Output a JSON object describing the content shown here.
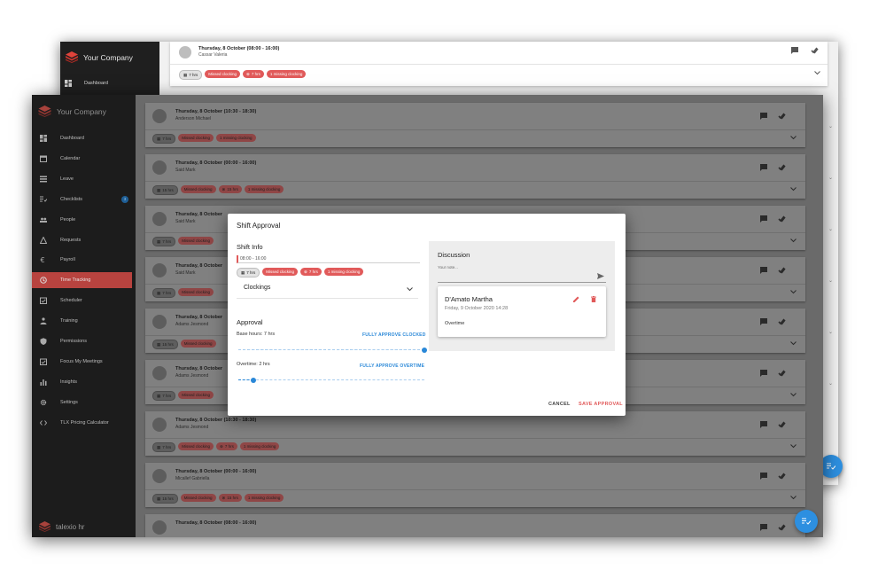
{
  "app": {
    "company_name": "Your Company",
    "footer_brand": "talexio hr"
  },
  "back_window": {
    "nav_item": "Dashboard",
    "card": {
      "title": "Thursday, 8 October (08:00 - 16:00)",
      "name": "Cassar Valeria",
      "chips": [
        "7 hrs",
        "Missed clocking",
        "7 hrs",
        "1 missing clocking"
      ]
    }
  },
  "sidebar": {
    "items": [
      {
        "label": "Dashboard",
        "icon": "dashboard-icon"
      },
      {
        "label": "Calendar",
        "icon": "calendar-icon"
      },
      {
        "label": "Leave",
        "icon": "leave-icon"
      },
      {
        "label": "Checklists",
        "icon": "checklist-icon",
        "badge": "3"
      },
      {
        "label": "People",
        "icon": "people-icon"
      },
      {
        "label": "Requests",
        "icon": "requests-icon"
      },
      {
        "label": "Payroll",
        "icon": "euro-icon"
      },
      {
        "label": "Time Tracking",
        "icon": "clock-icon",
        "active": true
      },
      {
        "label": "Scheduler",
        "icon": "scheduler-icon"
      },
      {
        "label": "Training",
        "icon": "training-icon"
      },
      {
        "label": "Permissions",
        "icon": "shield-icon"
      },
      {
        "label": "Focus My Meetings",
        "icon": "meetings-icon"
      },
      {
        "label": "Insights",
        "icon": "insights-icon"
      },
      {
        "label": "Settings",
        "icon": "gear-icon"
      },
      {
        "label": "TLX Pricing Calculator",
        "icon": "code-icon"
      }
    ]
  },
  "shifts": [
    {
      "title": "Thursday, 8 October (10:30 - 18:30)",
      "name": "Anderson Michael",
      "hours": "7 hrs",
      "missed": "Missed clocking",
      "clock_hours": "",
      "missing": "1 missing clocking"
    },
    {
      "title": "Thursday, 8 October (00:00 - 16:00)",
      "name": "Said Mark",
      "hours": "15 hrs",
      "missed": "Missed clocking",
      "clock_hours": "15 hrs",
      "missing": "1 missing clocking"
    },
    {
      "title": "Thursday, 8 October",
      "name": "Said Mark",
      "hours": "7 hrs",
      "missed": "Missed clocking",
      "clock_hours": "",
      "missing": ""
    },
    {
      "title": "Thursday, 8 October",
      "name": "Said Mark",
      "hours": "7 hrs",
      "missed": "Missed clocking",
      "clock_hours": "",
      "missing": ""
    },
    {
      "title": "Thursday, 8 October",
      "name": "Adams Jesmond",
      "hours": "15 hrs",
      "missed": "Missed clocking",
      "clock_hours": "",
      "missing": ""
    },
    {
      "title": "Thursday, 8 October",
      "name": "Adams Jesmond",
      "hours": "7 hrs",
      "missed": "Missed clocking",
      "clock_hours": "",
      "missing": ""
    },
    {
      "title": "Thursday, 8 October (10:30 - 18:30)",
      "name": "Adams Jesmond",
      "hours": "7 hrs",
      "missed": "Missed clocking",
      "clock_hours": "7 hrs",
      "missing": "1 missing clocking"
    },
    {
      "title": "Thursday, 8 October (00:00 - 16:00)",
      "name": "Micallef Gabriella",
      "hours": "15 hrs",
      "missed": "Missed clocking",
      "clock_hours": "15 hrs",
      "missing": "1 missing clocking"
    },
    {
      "title": "Thursday, 8 October (08:00 - 16:00)",
      "name": "",
      "hours": "",
      "missed": "",
      "clock_hours": "",
      "missing": ""
    }
  ],
  "dialog": {
    "title": "Shift Approval",
    "shift_info": {
      "heading": "Shift Info",
      "time_range": "08:00 - 16:00",
      "chips": [
        "7 hrs",
        "Missed clocking",
        "7 hrs",
        "1 missing clocking"
      ],
      "clockings_label": "Clockings"
    },
    "approval": {
      "heading": "Approval",
      "base_hours_label": "Base hours: 7 hrs",
      "approve_clocked": "FULLY APPROVE CLOCKED",
      "base_fraction": 1.0,
      "overtime_label": "Overtime: 2 hrs",
      "approve_overtime": "FULLY APPROVE OVERTIME",
      "overtime_fraction": 0.08
    },
    "discussion": {
      "heading": "Discussion",
      "note_placeholder": "Your note...",
      "note": {
        "author": "D'Amato Martha",
        "date": "Friday, 9 October 2020 14:28",
        "text": "Overtime"
      }
    },
    "cancel_label": "CANCEL",
    "save_label": "SAVE APPROVAL"
  },
  "colors": {
    "accent": "#2a88d8",
    "danger": "#e15a5a",
    "nav_active": "#b8433f"
  }
}
